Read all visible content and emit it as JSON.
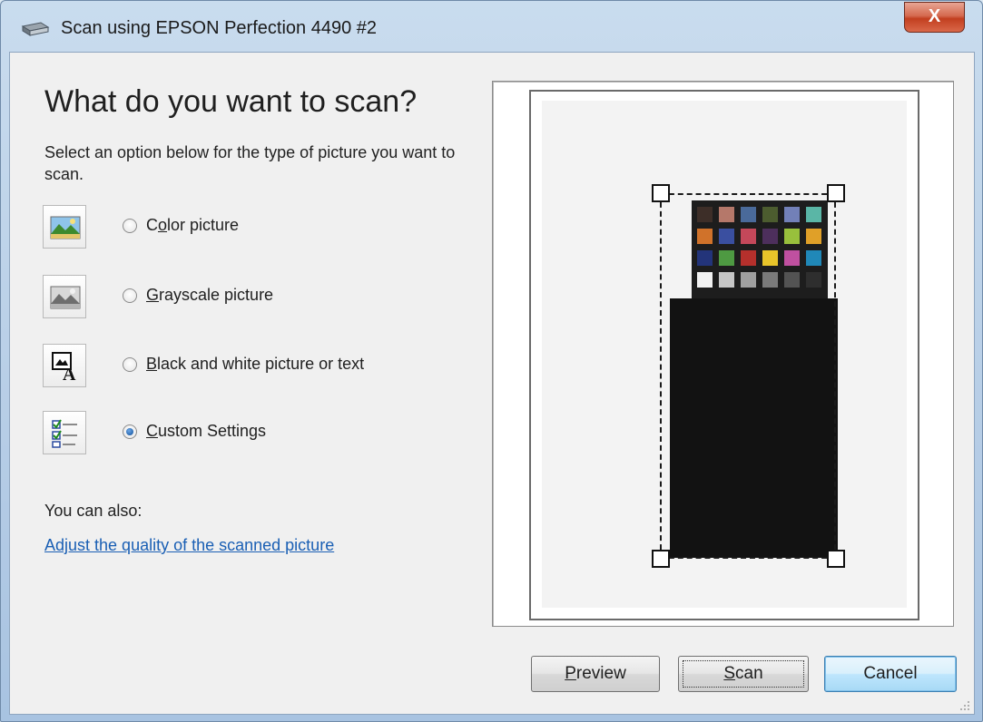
{
  "window": {
    "title": "Scan using EPSON Perfection 4490 #2",
    "close_glyph": "X"
  },
  "main": {
    "heading": "What do you want to scan?",
    "subtext": "Select an option below for the type of picture you want to scan.",
    "options": [
      {
        "label": "Color picture",
        "mnemonic": "o",
        "icon": "color-picture-icon",
        "selected": false
      },
      {
        "label": "Grayscale picture",
        "mnemonic": "G",
        "icon": "grayscale-picture-icon",
        "selected": false
      },
      {
        "label": "Black and white picture or text",
        "mnemonic": "B",
        "icon": "black-white-text-icon",
        "selected": false
      },
      {
        "label": "Custom Settings",
        "mnemonic": "C",
        "icon": "custom-settings-icon",
        "selected": true
      }
    ],
    "also_label": "You can also:",
    "adjust_link": "Adjust the quality of the scanned picture"
  },
  "buttons": {
    "preview": "Preview",
    "scan": "Scan",
    "cancel": "Cancel"
  },
  "colors": {
    "accent": "#1a5fb4",
    "checker_row1": [
      "#3d2e28",
      "#b5786a",
      "#4a6a9a",
      "#4c5c2f",
      "#7280b8",
      "#5ab6a6"
    ],
    "checker_row2": [
      "#d0722a",
      "#3a4fa0",
      "#c4485a",
      "#4d2f5c",
      "#98c03c",
      "#e0a028"
    ],
    "checker_row3": [
      "#23347a",
      "#4e9a42",
      "#b5302c",
      "#e8c42a",
      "#c050a0",
      "#2088b8"
    ],
    "checker_row4": [
      "#f2f2f2",
      "#c6c6c6",
      "#a0a0a0",
      "#7a7a7a",
      "#535353",
      "#2e2e2e"
    ]
  }
}
